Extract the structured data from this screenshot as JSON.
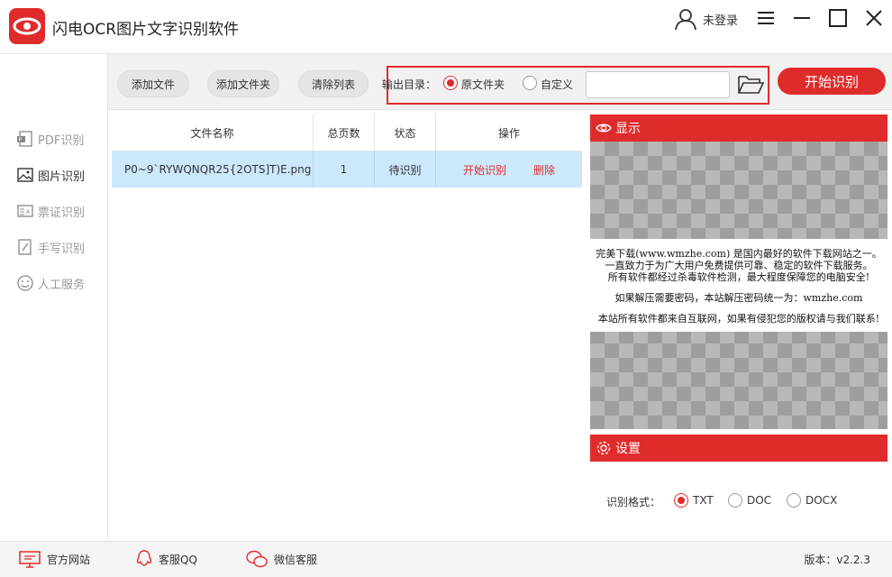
{
  "app": {
    "title": "闪电OCR图片文字识别软件"
  },
  "header": {
    "login": "未登录"
  },
  "sidebar": {
    "items": [
      {
        "label": "PDF识别",
        "icon": "pdf-icon"
      },
      {
        "label": "图片识别",
        "icon": "image-icon"
      },
      {
        "label": "票证识别",
        "icon": "ticket-icon"
      },
      {
        "label": "手写识别",
        "icon": "handwriting-icon"
      },
      {
        "label": "人工服务",
        "icon": "smiley-icon"
      }
    ]
  },
  "toolbar": {
    "add_file": "添加文件",
    "add_folder": "添加文件夹",
    "clear_list": "清除列表",
    "output_label": "输出目录：",
    "opt_original": "原文件夹",
    "opt_custom": "自定义",
    "path_value": "",
    "start": "开始识别"
  },
  "table": {
    "headers": [
      "文件名称",
      "总页数",
      "状态",
      "操作"
    ],
    "rows": [
      {
        "name": "P0~9`RYWQNQR25{2OTS]T)E.png",
        "pages": "1",
        "status": "待识别",
        "action_start": "开始识别",
        "action_delete": "删除"
      }
    ]
  },
  "preview": {
    "title": "显示",
    "notice": [
      "完美下载(www.wmzhe.com) 是国内最好的软件下载网站之一。",
      "一直致力于为广大用户免费提供可靠、稳定的软件下载服务。",
      "所有软件都经过杀毒软件检测，最大程度保障您的电脑安全!",
      "如果解压需要密码，本站解压密码统一为：wmzhe.com",
      "本站所有软件都来自互联网，如果有侵犯您的版权请与我们联系!"
    ]
  },
  "settings": {
    "title": "设置",
    "format_label": "识别格式：",
    "formats": [
      "TXT",
      "DOC",
      "DOCX"
    ],
    "selected_format": "TXT"
  },
  "footer": {
    "website": "官方网站",
    "qq": "客服QQ",
    "wechat": "微信客服",
    "version": "版本：v2.2.3"
  },
  "colors": {
    "accent": "#e02b2b",
    "selected_row": "#cce8fb"
  }
}
